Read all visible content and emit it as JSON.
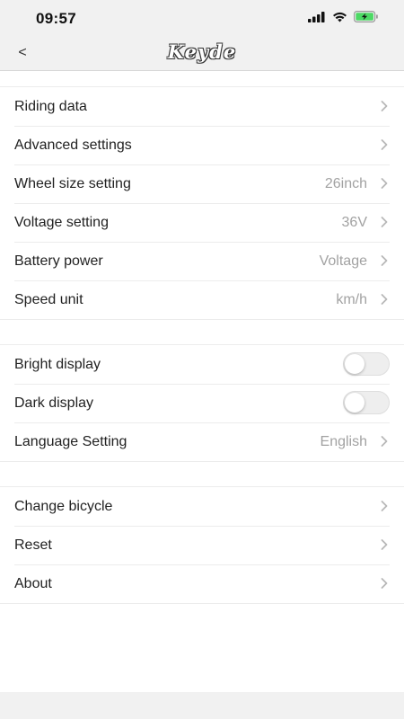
{
  "status_bar": {
    "time": "09:57",
    "icons": [
      "signal-icon",
      "wifi-icon",
      "battery-charging-icon"
    ]
  },
  "nav": {
    "back_label": "<",
    "title": "Keyde"
  },
  "colors": {
    "bar_background": "#f1f1f1",
    "value_text": "#a2a2a2",
    "battery_fill": "#4cd964"
  },
  "settings": {
    "group1": [
      {
        "label": "Riding data",
        "value": ""
      },
      {
        "label": "Advanced settings",
        "value": ""
      },
      {
        "label": "Wheel size setting",
        "value": "26inch"
      },
      {
        "label": "Voltage setting",
        "value": "36V"
      },
      {
        "label": "Battery power",
        "value": "Voltage"
      },
      {
        "label": "Speed unit",
        "value": "km/h"
      }
    ],
    "group2": [
      {
        "label": "Bright display",
        "toggle": false
      },
      {
        "label": "Dark display",
        "toggle": false
      },
      {
        "label": "Language Setting",
        "value": "English"
      }
    ],
    "group3": [
      {
        "label": "Change bicycle",
        "value": ""
      },
      {
        "label": "Reset",
        "value": ""
      },
      {
        "label": "About",
        "value": ""
      }
    ]
  }
}
